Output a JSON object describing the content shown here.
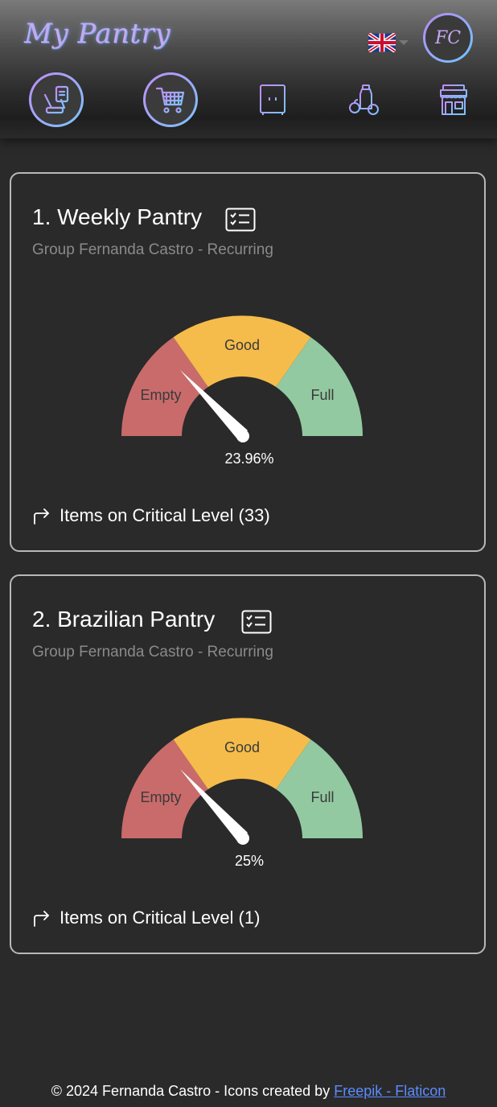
{
  "header": {
    "title": "My Pantry",
    "avatar_initials": "FC",
    "language": "en-GB",
    "nav": [
      {
        "icon": "cleaning-cart-icon",
        "active": true
      },
      {
        "icon": "shopping-cart-icon",
        "active": true
      },
      {
        "icon": "pantry-cabinet-icon",
        "active": false
      },
      {
        "icon": "groceries-icon",
        "active": false
      },
      {
        "icon": "store-icon",
        "active": false
      }
    ]
  },
  "pantries": [
    {
      "title": "1. Weekly Pantry",
      "subtitle": "Group Fernanda Castro - Recurring",
      "gauge": {
        "empty": "Empty",
        "good": "Good",
        "full": "Full",
        "value": 23.96,
        "value_label": "23.96%"
      },
      "critical_label": "Items on Critical Level (33)"
    },
    {
      "title": "2. Brazilian Pantry",
      "subtitle": "Group Fernanda Castro - Recurring",
      "gauge": {
        "empty": "Empty",
        "good": "Good",
        "full": "Full",
        "value": 25,
        "value_label": "25%"
      },
      "critical_label": "Items on Critical Level (1)"
    }
  ],
  "footer": {
    "text": "© 2024 Fernanda Castro - Icons created by ",
    "link": "Freepik - Flaticon"
  },
  "colors": {
    "empty": "#c96b6b",
    "good": "#f5bc4b",
    "full": "#92c9a1",
    "accent": "#c7a8f2",
    "link": "#5b8cff"
  }
}
